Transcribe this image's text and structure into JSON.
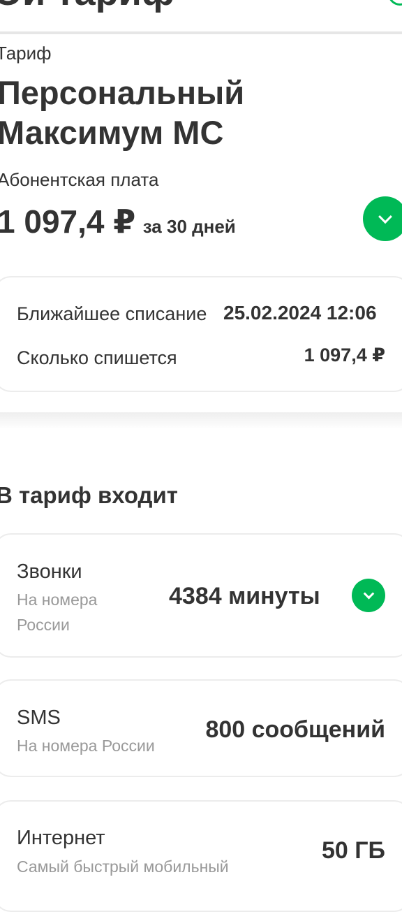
{
  "header": {
    "title": "Ой тариф"
  },
  "tariff": {
    "caption": "Тариф",
    "name_line1": "Персональный",
    "name_line2": "Максимум MC",
    "fee_caption": "Абонентская плата",
    "fee_amount": "1 097,4 ₽",
    "fee_period": "за 30 дней"
  },
  "billing": {
    "next_charge_label": "Ближайшее списание",
    "next_charge_value": "25.02.2024 12:06",
    "amount_label": "Сколько спишется",
    "amount_value": "1 097,4 ₽"
  },
  "included": {
    "title": "В тариф входит",
    "items": [
      {
        "name": "Звонки",
        "subtitle": "На номера России",
        "value": "4384 минуты"
      },
      {
        "name": "SMS",
        "subtitle": "На номера России",
        "value": "800 сообщений"
      },
      {
        "name": "Интернет",
        "subtitle": "Самый быстрый мобильный",
        "value": "50 ГБ"
      }
    ]
  },
  "colors": {
    "accent": "#00b956",
    "text": "#333333",
    "muted": "#999999"
  },
  "icons": [
    "chevron-down-icon"
  ]
}
